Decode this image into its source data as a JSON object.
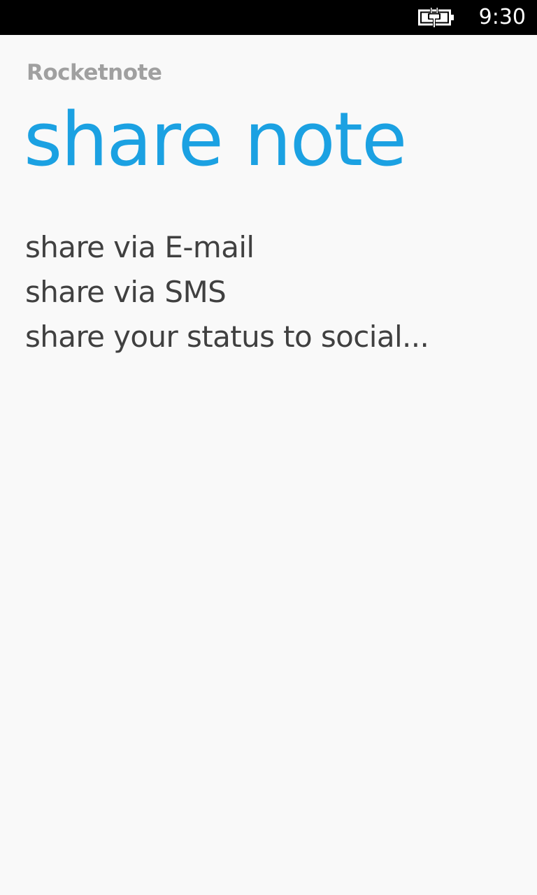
{
  "status_bar": {
    "battery_icon": "battery-charging-icon",
    "time": "9:30"
  },
  "header": {
    "app_name": "Rocketnote",
    "page_title": "share note"
  },
  "share_options": [
    {
      "label": "share via E-mail"
    },
    {
      "label": "share via SMS"
    },
    {
      "label": "share your status to social..."
    }
  ],
  "colors": {
    "accent": "#1ba1e2",
    "background": "#f9f9f9",
    "status_bar": "#000000",
    "app_name": "#a0a0a0",
    "item_text": "#404040"
  }
}
